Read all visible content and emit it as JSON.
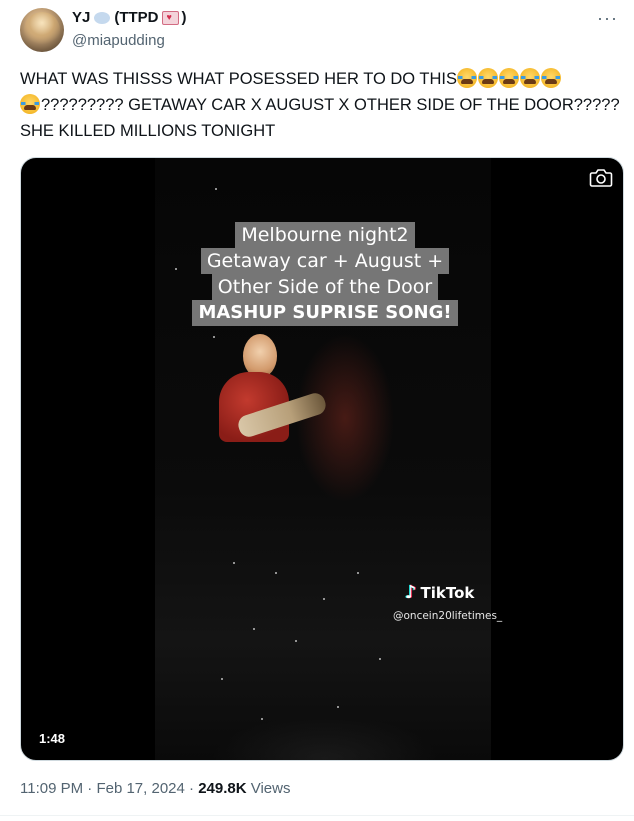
{
  "author": {
    "name_prefix": "YJ",
    "name_paren_open": "(TTPD",
    "name_paren_close": ")",
    "handle": "@miapudding",
    "avatar_icon": "profile-photo"
  },
  "tweet": {
    "text_part1": "WHAT WAS THISSS WHAT POSESSED HER TO DO THIS",
    "text_part2": "????????? GETAWAY CAR X AUGUST X OTHER SIDE OF THE DOOR????? SHE KILLED MILLIONS TONIGHT",
    "emoji": "loudly-crying-face",
    "emoji_count_line1": 5,
    "emoji_count_line2": 1
  },
  "media": {
    "caption_lines": [
      "Melbourne night2",
      "Getaway car + August +",
      "Other Side of the Door",
      "MASHUP SUPRISE SONG!"
    ],
    "watermark": "TikTok",
    "watermark_handle": "@oncein20lifetimes_",
    "duration": "1:48",
    "camera_icon": "camera-icon"
  },
  "meta": {
    "time": "11:09 PM",
    "dot": "·",
    "date": "Feb 17, 2024",
    "views_count": "249.8K",
    "views_label": "Views"
  },
  "menu": {
    "more_label": "···"
  }
}
